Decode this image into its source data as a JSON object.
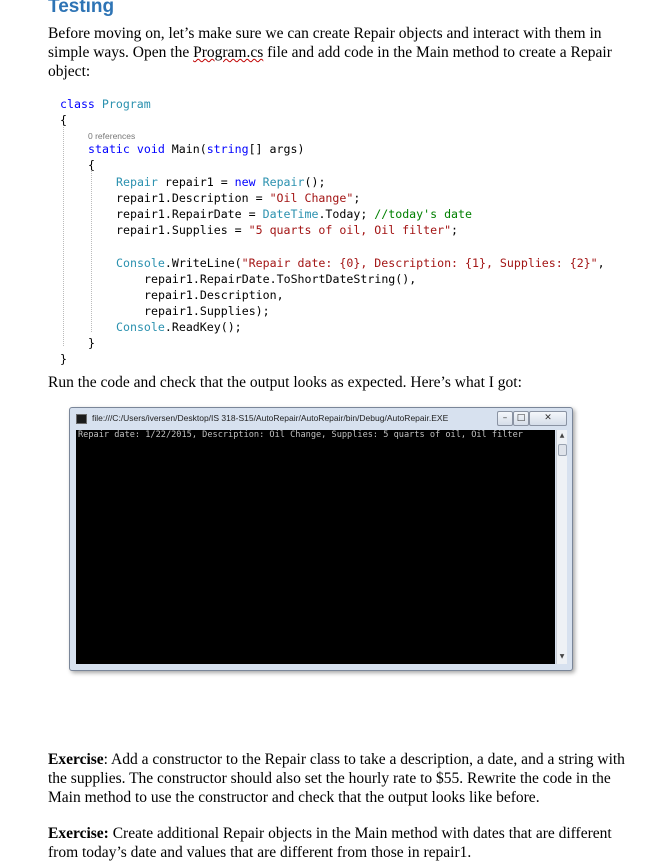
{
  "heading": "Testing",
  "intro": {
    "before": "Before moving on, let’s make sure we can create Repair objects and interact with them in simple ways. Open the ",
    "filename": "Program.cs",
    "after": " file and add code in the Main method to create a Repair object:"
  },
  "code": {
    "class_kw": "class",
    "class_name": "Program",
    "brace_open": "{",
    "brace_close": "}",
    "references": "0 references",
    "main_sig": {
      "static": "static",
      "void": "void",
      "rest_a": " Main(",
      "string": "string",
      "rest_b": "[] args)"
    },
    "line_repair1": {
      "type": "Repair",
      "mid": " repair1 = ",
      "new": "new",
      "sp": " ",
      "type2": "Repair",
      "end": "();"
    },
    "line_desc": {
      "lhs": "repair1.Description = ",
      "str": "\"Oil Change\"",
      "end": ";"
    },
    "line_date": {
      "lhs": "repair1.RepairDate = ",
      "type": "DateTime",
      "mid": ".Today; ",
      "comment": "//today's date"
    },
    "line_supplies": {
      "lhs": "repair1.Supplies = ",
      "str": "\"5 quarts of oil, Oil filter\"",
      "end": ";"
    },
    "line_write": {
      "type": "Console",
      "mid": ".WriteLine(",
      "str": "\"Repair date: {0}, Description: {1}, Supplies: {2}\"",
      "end": ","
    },
    "line_arg1": "repair1.RepairDate.ToShortDateString(),",
    "line_arg2": "repair1.Description,",
    "line_arg3": "repair1.Supplies);",
    "line_readkey": {
      "type": "Console",
      "end": ".ReadKey();"
    }
  },
  "run_text": "Run the code and check that the output looks as expected. Here’s what I got:",
  "console": {
    "title": "file:///C:/Users/iversen/Desktop/IS 318-S15/AutoRepair/AutoRepair/bin/Debug/AutoRepair.EXE",
    "output": "Repair date: 1/22/2015, Description: Oil Change, Supplies: 5 quarts of oil, Oil filter",
    "minimize": "–",
    "maximize": "□",
    "close": "✕"
  },
  "exercise1": {
    "label": "Exercise",
    "colon": ":",
    "text": " Add a constructor to the Repair class to take a description, a date, and a string with the supplies. The constructor should also set the hourly rate to $55. Rewrite the code in the Main method to use the constructor and check that the output looks like before."
  },
  "exercise2": {
    "label": "Exercise:",
    "text": " Create additional Repair objects in the Main method with dates that are different from today’s date and values that are different from those in repair1."
  }
}
